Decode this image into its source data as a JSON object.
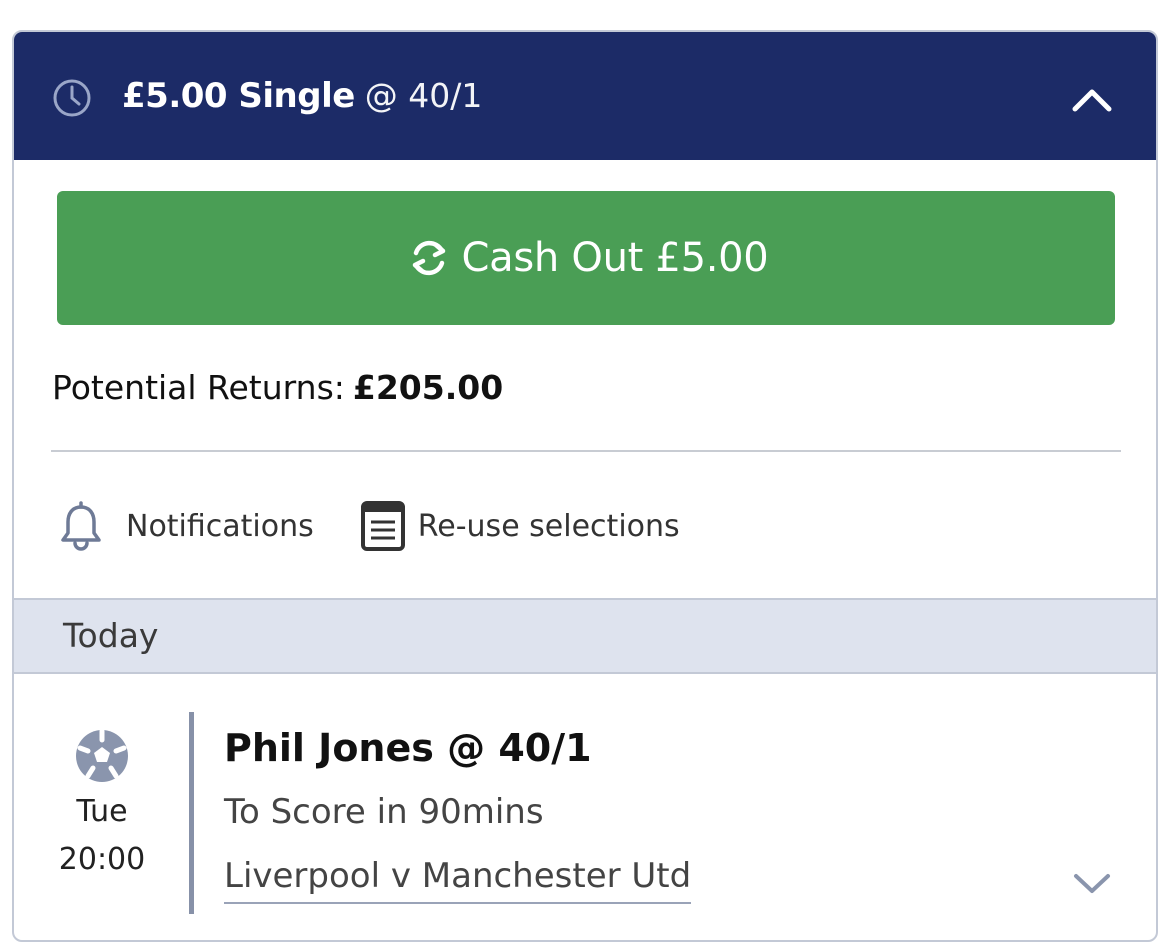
{
  "header": {
    "stake_type": "£5.00 Single",
    "odds": "@ 40/1",
    "icon": "clock-icon",
    "collapse_icon": "chevron-up-icon"
  },
  "cashout": {
    "label": "Cash Out £5.00",
    "icon": "refresh-icon"
  },
  "returns": {
    "label": "Potential Returns:",
    "value": "£205.00"
  },
  "actions": [
    {
      "label": "Notifications",
      "icon": "bell-icon"
    },
    {
      "label": "Re-use selections",
      "icon": "document-icon"
    }
  ],
  "section": {
    "label": "Today"
  },
  "selection": {
    "sport_icon": "football-icon",
    "day": "Tue",
    "time": "20:00",
    "name": "Phil Jones @ 40/1",
    "market": "To Score in 90mins",
    "event": "Liverpool v Manchester Utd",
    "expand_icon": "chevron-down-icon"
  },
  "colors": {
    "header_bg": "#1c2b67",
    "cashout_bg": "#4a9e55",
    "section_bg": "#dee3ee",
    "border": "#c3c9d6"
  }
}
